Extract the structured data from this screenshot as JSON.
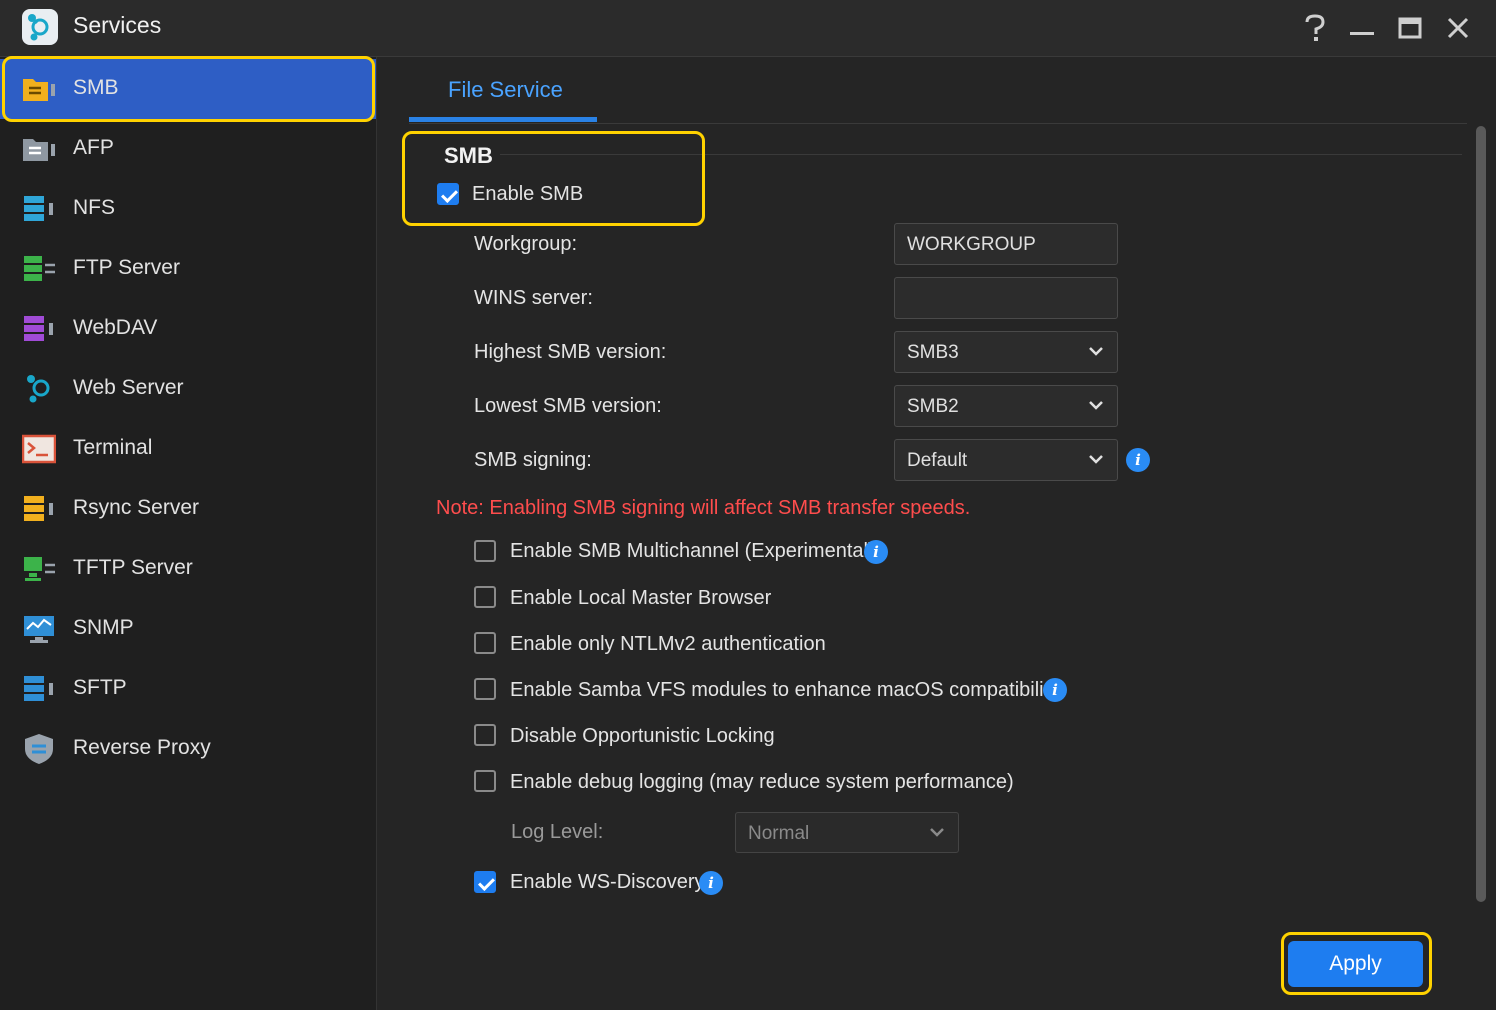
{
  "window": {
    "title": "Services"
  },
  "sidebar": {
    "items": [
      {
        "label": "SMB",
        "icon": "folder-share-icon",
        "active": true
      },
      {
        "label": "AFP",
        "icon": "folder-transfer-icon"
      },
      {
        "label": "NFS",
        "icon": "server-stack-icon"
      },
      {
        "label": "FTP Server",
        "icon": "ftp-server-icon"
      },
      {
        "label": "WebDAV",
        "icon": "webdav-icon"
      },
      {
        "label": "Web Server",
        "icon": "web-server-icon"
      },
      {
        "label": "Terminal",
        "icon": "terminal-icon"
      },
      {
        "label": "Rsync Server",
        "icon": "rsync-icon"
      },
      {
        "label": "TFTP Server",
        "icon": "tftp-icon"
      },
      {
        "label": "SNMP",
        "icon": "monitor-icon"
      },
      {
        "label": "SFTP",
        "icon": "sftp-icon"
      },
      {
        "label": "Reverse Proxy",
        "icon": "shield-icon"
      }
    ]
  },
  "tabs": [
    {
      "label": "File Service",
      "active": true
    }
  ],
  "smb": {
    "section_title": "SMB",
    "enable_label": "Enable SMB",
    "enable_checked": true,
    "workgroup_label": "Workgroup:",
    "workgroup_value": "WORKGROUP",
    "wins_label": "WINS server:",
    "wins_value": "",
    "highest_label": "Highest SMB version:",
    "highest_value": "SMB3",
    "lowest_label": "Lowest SMB version:",
    "lowest_value": "SMB2",
    "signing_label": "SMB signing:",
    "signing_value": "Default",
    "note": "Note: Enabling SMB signing will affect SMB transfer speeds.",
    "options": [
      {
        "label": "Enable SMB Multichannel (Experimental)",
        "checked": false,
        "info": true
      },
      {
        "label": "Enable Local Master Browser",
        "checked": false,
        "info": false
      },
      {
        "label": "Enable only NTLMv2 authentication",
        "checked": false,
        "info": false
      },
      {
        "label": "Enable Samba VFS modules to enhance macOS compatibility.",
        "checked": false,
        "info": true
      },
      {
        "label": "Disable Opportunistic Locking",
        "checked": false,
        "info": false
      },
      {
        "label": "Enable debug logging (may reduce system performance)",
        "checked": false,
        "info": false
      }
    ],
    "log_level_label": "Log Level:",
    "log_level_value": "Normal",
    "ws_discovery_label": "Enable WS-Discovery",
    "ws_discovery_checked": true
  },
  "footer": {
    "apply_label": "Apply"
  },
  "colors": {
    "accent": "#1e7df0",
    "highlight": "#ffd200",
    "note": "#ff4d4d",
    "tab": "#4aa3ff"
  }
}
